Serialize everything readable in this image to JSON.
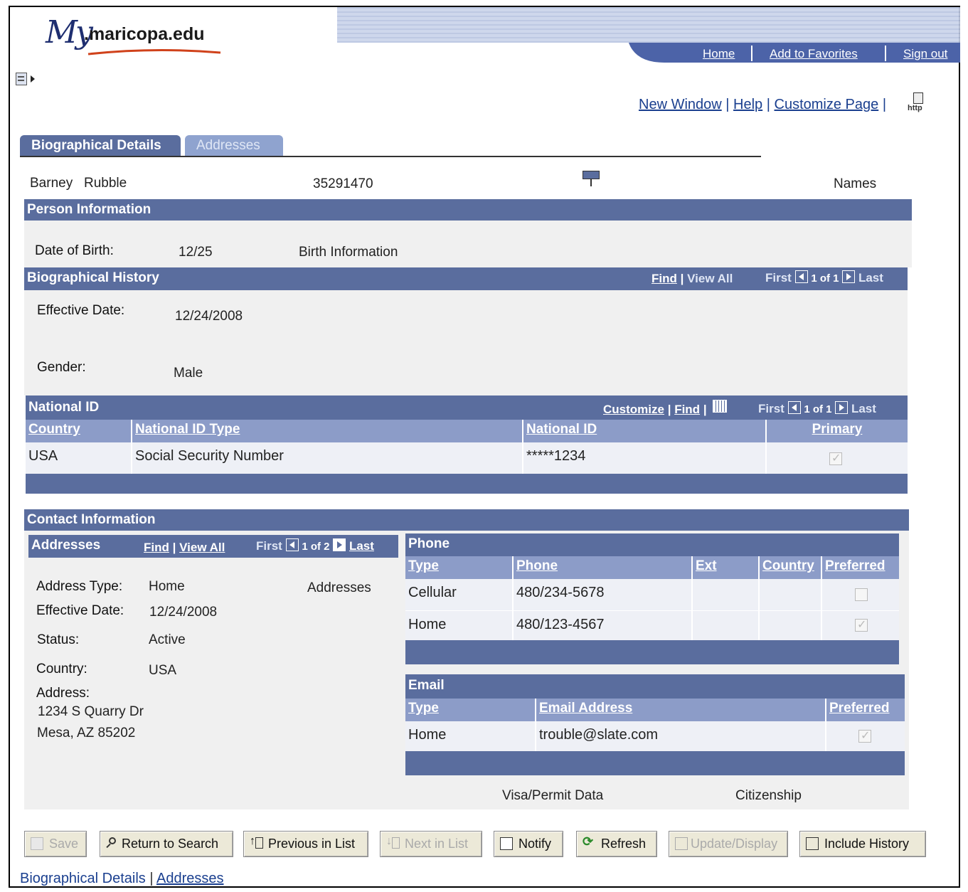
{
  "header": {
    "logo_my": "My",
    "logo_domain": ".maricopa.edu",
    "links": [
      "Home",
      "Add to Favorites",
      "Sign out"
    ],
    "util_links": [
      "New Window",
      "Help",
      "Customize Page"
    ],
    "http_label": "http"
  },
  "tabs": [
    {
      "label": "Biographical Details",
      "active": true
    },
    {
      "label": "Addresses",
      "active": false
    }
  ],
  "person": {
    "first_name": "Barney",
    "last_name": "Rubble",
    "id": "35291470",
    "names_link": "Names"
  },
  "person_info": {
    "title": "Person Information",
    "dob_label": "Date of Birth:",
    "dob_value": "12/25",
    "birth_info_link": "Birth Information"
  },
  "bio_history": {
    "title": "Biographical History",
    "find": "Find",
    "view_all": "View All",
    "first": "First",
    "count": "1 of 1",
    "last": "Last",
    "effective_date_label": "Effective Date:",
    "effective_date_value": "12/24/2008",
    "gender_label": "Gender:",
    "gender_value": "Male"
  },
  "national_id": {
    "title": "National ID",
    "customize": "Customize",
    "find": "Find",
    "first": "First",
    "count": "1 of 1",
    "last": "Last",
    "columns": [
      "Country",
      "National ID Type",
      "National ID",
      "Primary"
    ],
    "rows": [
      {
        "country": "USA",
        "type": "Social Security Number",
        "id": "*****1234",
        "primary": true
      }
    ]
  },
  "contact": {
    "title": "Contact Information",
    "addresses": {
      "title": "Addresses",
      "find": "Find",
      "view_all": "View All",
      "first": "First",
      "count": "1 of 2",
      "last": "Last",
      "address_type_label": "Address Type:",
      "address_type_value": "Home",
      "addresses_link": "Addresses",
      "effective_date_label": "Effective Date:",
      "effective_date_value": "12/24/2008",
      "status_label": "Status:",
      "status_value": "Active",
      "country_label": "Country:",
      "country_value": "USA",
      "address_label": "Address:",
      "address_line1": "1234 S Quarry Dr",
      "address_line2": "Mesa, AZ 85202"
    },
    "phone": {
      "title": "Phone",
      "columns": [
        "Type",
        "Phone",
        "Ext",
        "Country",
        "Preferred"
      ],
      "rows": [
        {
          "type": "Cellular",
          "phone": "480/234-5678",
          "ext": "",
          "country": "",
          "preferred": false
        },
        {
          "type": "Home",
          "phone": "480/123-4567",
          "ext": "",
          "country": "",
          "preferred": true
        }
      ]
    },
    "email": {
      "title": "Email",
      "columns": [
        "Type",
        "Email Address",
        "Preferred"
      ],
      "rows": [
        {
          "type": "Home",
          "address": "trouble@slate.com",
          "preferred": true
        }
      ]
    },
    "visa_link": "Visa/Permit Data",
    "citizenship_link": "Citizenship"
  },
  "toolbar": {
    "save": "Save",
    "return_to_search": "Return to Search",
    "previous_in_list": "Previous in List",
    "next_in_list": "Next in List",
    "notify": "Notify",
    "refresh": "Refresh",
    "update_display": "Update/Display",
    "include_history": "Include History"
  },
  "footer": {
    "current": "Biographical Details",
    "link": "Addresses"
  },
  "colors": {
    "header_bar": "#5a6d9e",
    "column_header": "#8c9cc8",
    "row_bg": "#eef0f6",
    "panel_bg": "#f0f0f0",
    "link": "#1a3f8f",
    "logo_accent": "#d0421b"
  }
}
